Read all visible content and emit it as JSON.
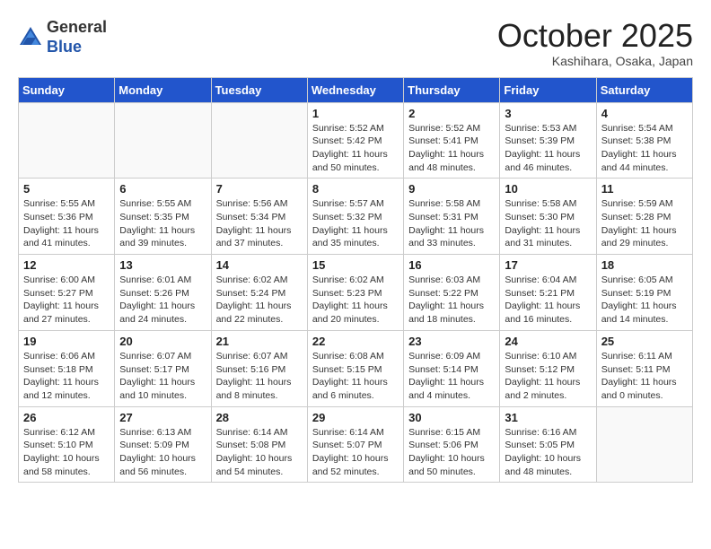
{
  "header": {
    "logo_general": "General",
    "logo_blue": "Blue",
    "month_title": "October 2025",
    "location": "Kashihara, Osaka, Japan"
  },
  "weekdays": [
    "Sunday",
    "Monday",
    "Tuesday",
    "Wednesday",
    "Thursday",
    "Friday",
    "Saturday"
  ],
  "weeks": [
    [
      {
        "day": "",
        "info": ""
      },
      {
        "day": "",
        "info": ""
      },
      {
        "day": "",
        "info": ""
      },
      {
        "day": "1",
        "info": "Sunrise: 5:52 AM\nSunset: 5:42 PM\nDaylight: 11 hours\nand 50 minutes."
      },
      {
        "day": "2",
        "info": "Sunrise: 5:52 AM\nSunset: 5:41 PM\nDaylight: 11 hours\nand 48 minutes."
      },
      {
        "day": "3",
        "info": "Sunrise: 5:53 AM\nSunset: 5:39 PM\nDaylight: 11 hours\nand 46 minutes."
      },
      {
        "day": "4",
        "info": "Sunrise: 5:54 AM\nSunset: 5:38 PM\nDaylight: 11 hours\nand 44 minutes."
      }
    ],
    [
      {
        "day": "5",
        "info": "Sunrise: 5:55 AM\nSunset: 5:36 PM\nDaylight: 11 hours\nand 41 minutes."
      },
      {
        "day": "6",
        "info": "Sunrise: 5:55 AM\nSunset: 5:35 PM\nDaylight: 11 hours\nand 39 minutes."
      },
      {
        "day": "7",
        "info": "Sunrise: 5:56 AM\nSunset: 5:34 PM\nDaylight: 11 hours\nand 37 minutes."
      },
      {
        "day": "8",
        "info": "Sunrise: 5:57 AM\nSunset: 5:32 PM\nDaylight: 11 hours\nand 35 minutes."
      },
      {
        "day": "9",
        "info": "Sunrise: 5:58 AM\nSunset: 5:31 PM\nDaylight: 11 hours\nand 33 minutes."
      },
      {
        "day": "10",
        "info": "Sunrise: 5:58 AM\nSunset: 5:30 PM\nDaylight: 11 hours\nand 31 minutes."
      },
      {
        "day": "11",
        "info": "Sunrise: 5:59 AM\nSunset: 5:28 PM\nDaylight: 11 hours\nand 29 minutes."
      }
    ],
    [
      {
        "day": "12",
        "info": "Sunrise: 6:00 AM\nSunset: 5:27 PM\nDaylight: 11 hours\nand 27 minutes."
      },
      {
        "day": "13",
        "info": "Sunrise: 6:01 AM\nSunset: 5:26 PM\nDaylight: 11 hours\nand 24 minutes."
      },
      {
        "day": "14",
        "info": "Sunrise: 6:02 AM\nSunset: 5:24 PM\nDaylight: 11 hours\nand 22 minutes."
      },
      {
        "day": "15",
        "info": "Sunrise: 6:02 AM\nSunset: 5:23 PM\nDaylight: 11 hours\nand 20 minutes."
      },
      {
        "day": "16",
        "info": "Sunrise: 6:03 AM\nSunset: 5:22 PM\nDaylight: 11 hours\nand 18 minutes."
      },
      {
        "day": "17",
        "info": "Sunrise: 6:04 AM\nSunset: 5:21 PM\nDaylight: 11 hours\nand 16 minutes."
      },
      {
        "day": "18",
        "info": "Sunrise: 6:05 AM\nSunset: 5:19 PM\nDaylight: 11 hours\nand 14 minutes."
      }
    ],
    [
      {
        "day": "19",
        "info": "Sunrise: 6:06 AM\nSunset: 5:18 PM\nDaylight: 11 hours\nand 12 minutes."
      },
      {
        "day": "20",
        "info": "Sunrise: 6:07 AM\nSunset: 5:17 PM\nDaylight: 11 hours\nand 10 minutes."
      },
      {
        "day": "21",
        "info": "Sunrise: 6:07 AM\nSunset: 5:16 PM\nDaylight: 11 hours\nand 8 minutes."
      },
      {
        "day": "22",
        "info": "Sunrise: 6:08 AM\nSunset: 5:15 PM\nDaylight: 11 hours\nand 6 minutes."
      },
      {
        "day": "23",
        "info": "Sunrise: 6:09 AM\nSunset: 5:14 PM\nDaylight: 11 hours\nand 4 minutes."
      },
      {
        "day": "24",
        "info": "Sunrise: 6:10 AM\nSunset: 5:12 PM\nDaylight: 11 hours\nand 2 minutes."
      },
      {
        "day": "25",
        "info": "Sunrise: 6:11 AM\nSunset: 5:11 PM\nDaylight: 11 hours\nand 0 minutes."
      }
    ],
    [
      {
        "day": "26",
        "info": "Sunrise: 6:12 AM\nSunset: 5:10 PM\nDaylight: 10 hours\nand 58 minutes."
      },
      {
        "day": "27",
        "info": "Sunrise: 6:13 AM\nSunset: 5:09 PM\nDaylight: 10 hours\nand 56 minutes."
      },
      {
        "day": "28",
        "info": "Sunrise: 6:14 AM\nSunset: 5:08 PM\nDaylight: 10 hours\nand 54 minutes."
      },
      {
        "day": "29",
        "info": "Sunrise: 6:14 AM\nSunset: 5:07 PM\nDaylight: 10 hours\nand 52 minutes."
      },
      {
        "day": "30",
        "info": "Sunrise: 6:15 AM\nSunset: 5:06 PM\nDaylight: 10 hours\nand 50 minutes."
      },
      {
        "day": "31",
        "info": "Sunrise: 6:16 AM\nSunset: 5:05 PM\nDaylight: 10 hours\nand 48 minutes."
      },
      {
        "day": "",
        "info": ""
      }
    ]
  ]
}
